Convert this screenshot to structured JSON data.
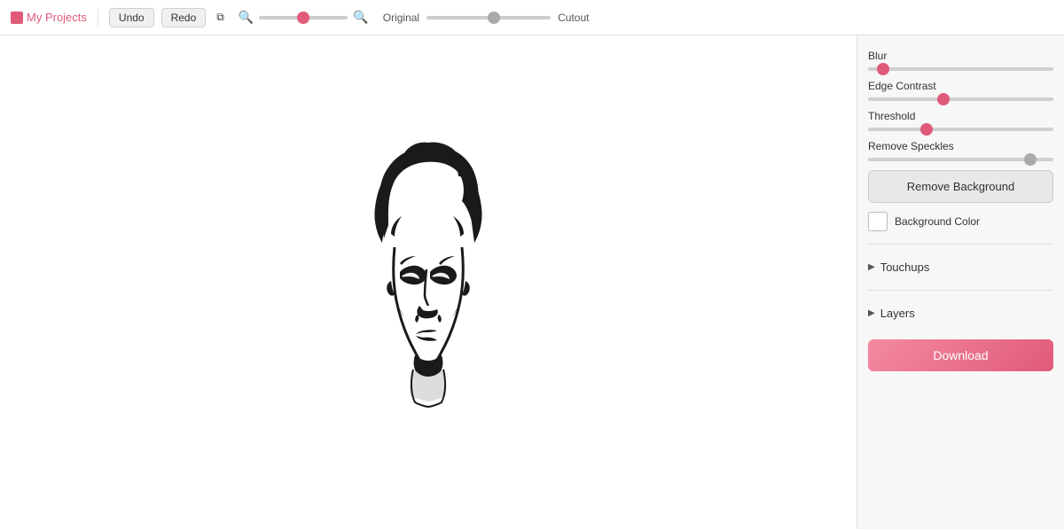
{
  "toolbar": {
    "my_projects_label": "My Projects",
    "undo_label": "Undo",
    "redo_label": "Redo",
    "zoom_icon_minus": "🔍",
    "zoom_icon_plus": "🔍",
    "view_original_label": "Original",
    "view_cutout_label": "Cutout",
    "zoom_value": 50,
    "view_value": 55
  },
  "panel": {
    "blur_label": "Blur",
    "blur_value": 5,
    "edge_contrast_label": "Edge Contrast",
    "edge_contrast_value": 40,
    "threshold_label": "Threshold",
    "threshold_value": 30,
    "remove_speckles_label": "Remove Speckles",
    "remove_speckles_value": 90,
    "remove_bg_label": "Remove Background",
    "bg_color_label": "Background Color",
    "touchups_label": "Touchups",
    "layers_label": "Layers",
    "download_label": "Download"
  },
  "colors": {
    "accent": "#e05a7a",
    "download_bg": "#f48aa0"
  }
}
